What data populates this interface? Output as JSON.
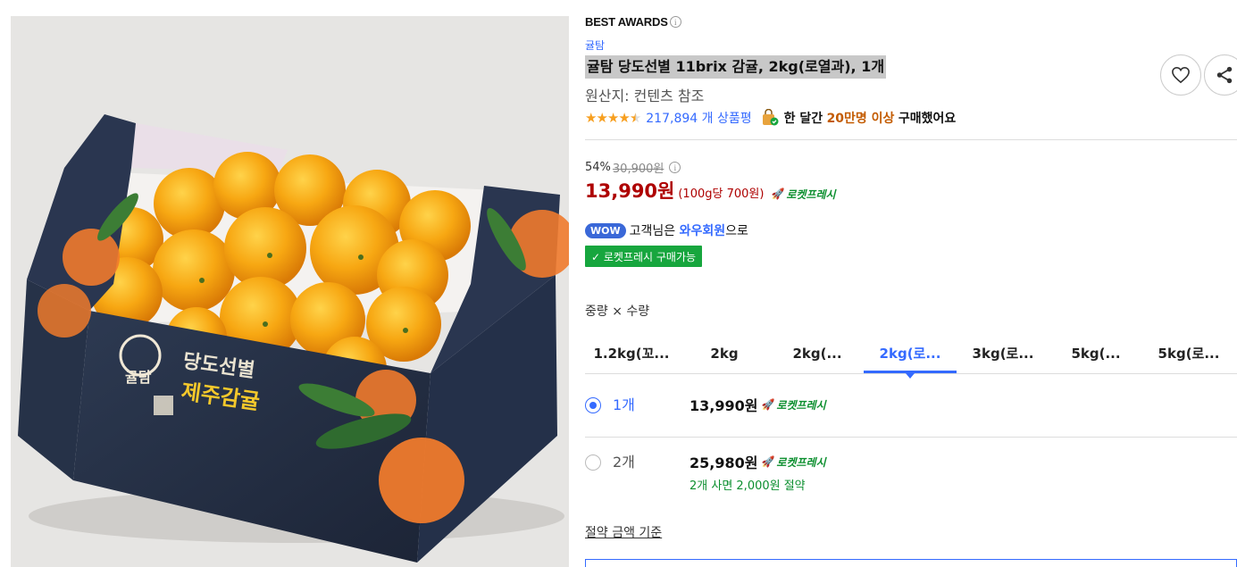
{
  "product_image": {
    "alt": "귤탐 당도선별 제주감귤 박스",
    "box_brand": "귤탐",
    "box_tagline": "당도선별",
    "box_title": "제주감귤"
  },
  "awards": {
    "label": "BEST AWARDS",
    "info_icon": "info-circle-icon"
  },
  "brand": "귤탐",
  "title": "귤탐 당도선별 11brix 감귤, 2kg(로열과), 1개",
  "origin": "원산지: 컨텐츠 참조",
  "rating": {
    "stars": 4.5,
    "review_count": "217,894 개 상품평"
  },
  "purchase_stat": {
    "prefix": "한 달간",
    "highlight": "20만명 이상",
    "suffix": "구매했어요"
  },
  "pricing": {
    "discount_rate": "54%",
    "original_price": "30,900원",
    "sale_price": "13,990원",
    "unit_price": "(100g당 700원)",
    "delivery_badge": "로켓프레시"
  },
  "wow": {
    "badge": "WOW",
    "prefix": "고객님은",
    "highlight": "와우회원",
    "suffix": "으로"
  },
  "fresh_badge": "✓ 로켓프레시 구매가능",
  "option_label": "중량 × 수량",
  "tabs": [
    {
      "label": "1.2kg(꼬..."
    },
    {
      "label": "2kg"
    },
    {
      "label": "2kg(..."
    },
    {
      "label": "2kg(로..."
    },
    {
      "label": "3kg(로..."
    },
    {
      "label": "5kg(..."
    },
    {
      "label": "5kg(로..."
    }
  ],
  "active_tab_index": 3,
  "quantities": [
    {
      "name": "1개",
      "price": "13,990원",
      "delivery": "로켓프레시",
      "selected": true,
      "note": ""
    },
    {
      "name": "2개",
      "price": "25,980원",
      "delivery": "로켓프레시",
      "selected": false,
      "note": "2개 사면 2,000원 절약"
    }
  ],
  "criteria_link": "절약 금액 기준",
  "colors": {
    "accent_blue": "#346aff",
    "price_red": "#ae0000",
    "rocket_green": "#0c8f2f",
    "star_orange": "#f79f1f"
  }
}
